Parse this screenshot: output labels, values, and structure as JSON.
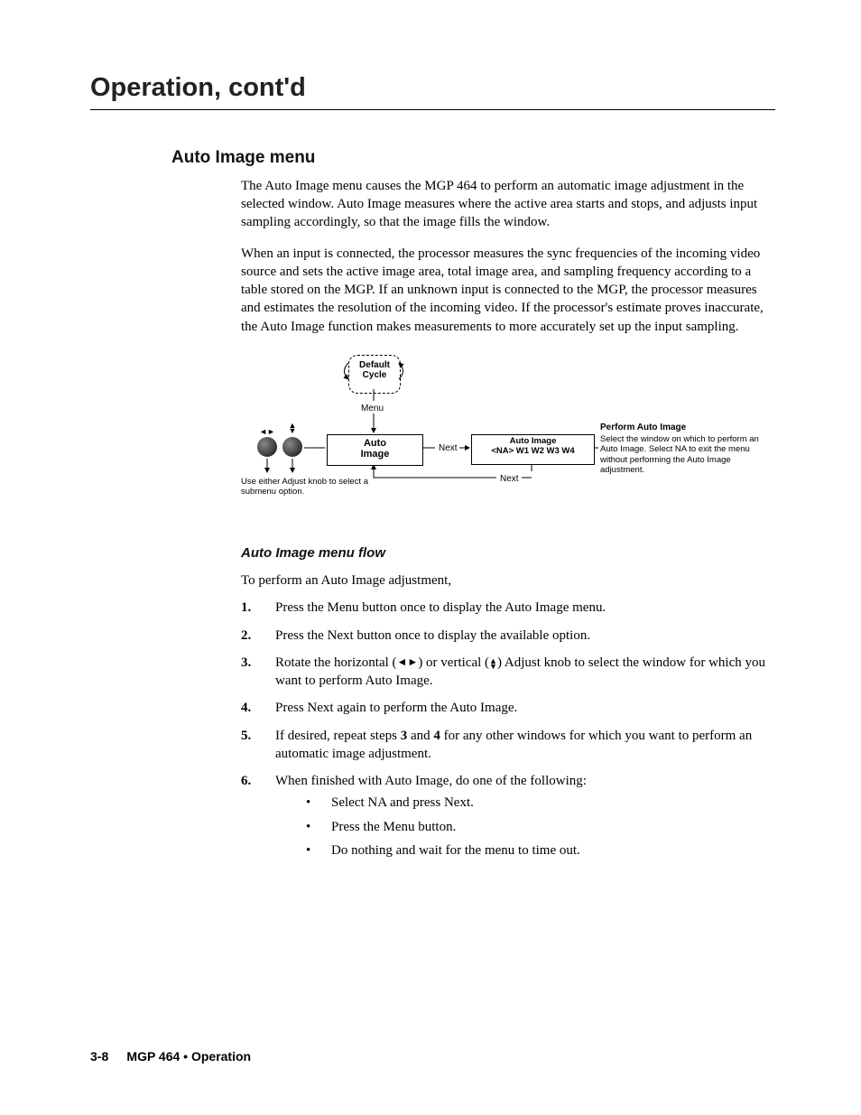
{
  "chapter_title": "Operation, cont'd",
  "h2": "Auto Image menu",
  "para1": "The Auto Image menu causes the MGP 464 to perform an automatic image adjustment in the selected window.  Auto Image measures where the active area starts and stops, and adjusts input sampling accordingly, so that the image fills the window.",
  "para2": "When an input is connected, the processor measures the sync frequencies of the incoming video source and sets the active image area, total image area, and sampling frequency according to a table stored on the MGP.  If an unknown input is connected to the MGP, the processor measures and estimates the resolution of the incoming video.  If the processor's estimate proves inaccurate, the Auto Image function makes measurements to more accurately set up the input sampling.",
  "diagram": {
    "default_cycle_l1": "Default",
    "default_cycle_l2": "Cycle",
    "menu_label": "Menu",
    "auto_image_l1": "Auto",
    "auto_image_l2": "Image",
    "next1": "Next",
    "submenu_l1": "Auto Image",
    "submenu_l2": "<NA>  W1  W2  W3  W4",
    "next2": "Next",
    "knob_caption": "Use either Adjust knob to select a submenu option.",
    "right_title": "Perform Auto Image",
    "right_body": "Select the window on which to perform an Auto Image. Select NA to exit the menu without performing the Auto Image adjustment."
  },
  "flow_title": "Auto Image menu flow",
  "intro": "To perform an Auto Image adjustment,",
  "steps": [
    {
      "n": "1.",
      "t": "Press the Menu button once to display the Auto Image menu."
    },
    {
      "n": "2.",
      "t": "Press the Next button once to display the available option."
    },
    {
      "n": "3.",
      "t_pre": "Rotate the horizontal (",
      "t_mid": ") or vertical (",
      "t_post": ") Adjust knob to select the window for which you want to perform Auto Image."
    },
    {
      "n": "4.",
      "t": "Press Next again to perform the Auto Image."
    },
    {
      "n": "5.",
      "t_pre": "If desired, repeat steps ",
      "t_b1": "3",
      "t_mid": " and ",
      "t_b2": "4",
      "t_post": " for any other windows for which you want to perform an automatic image adjustment."
    },
    {
      "n": "6.",
      "t": "When finished with Auto Image, do one of the following:"
    }
  ],
  "bullets": [
    "Select NA and press Next.",
    "Press the Menu button.",
    "Do nothing and wait for the menu to time out."
  ],
  "footer": {
    "page_num": "3-8",
    "text": "MGP 464 • Operation"
  }
}
